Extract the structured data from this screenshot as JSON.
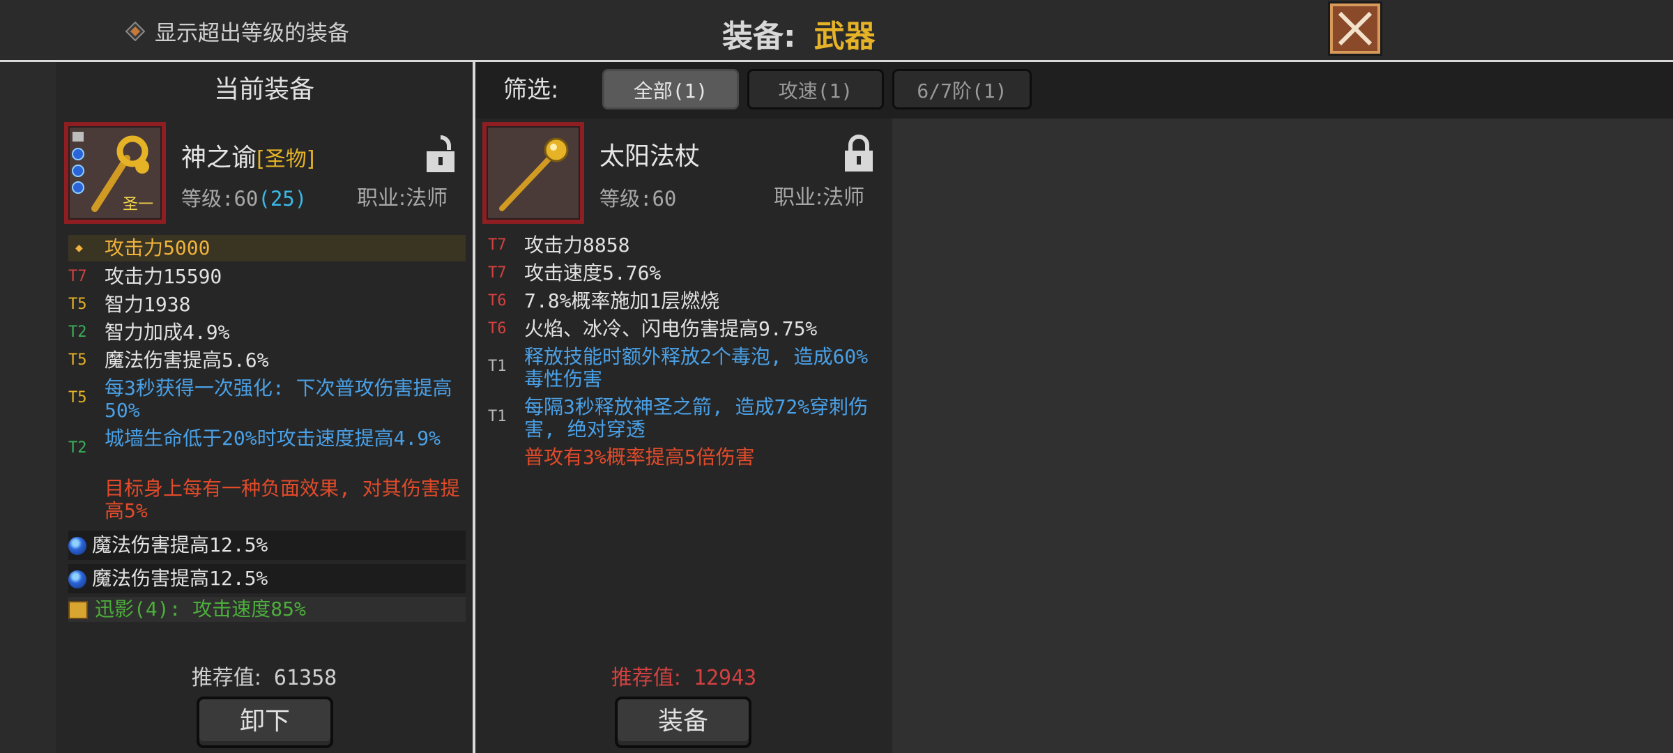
{
  "topbar": {
    "toggle_label": "显示超出等级的装备",
    "title_label": "装备:",
    "title_value": "武器"
  },
  "current": {
    "header": "当前装备",
    "name": "神之谕",
    "tag": "[圣物]",
    "icon_sub": "圣一",
    "level_label": "等级:",
    "level": "60",
    "level_bonus": "(25)",
    "class_label": "职业:",
    "class": "法师",
    "main_stat": "攻击力5000",
    "stats": [
      {
        "tier": "T7",
        "text": "攻击力15590"
      },
      {
        "tier": "T5",
        "text": "智力1938"
      },
      {
        "tier": "T2",
        "text": "智力加成4.9%"
      },
      {
        "tier": "T5",
        "text": "魔法伤害提高5.6%"
      },
      {
        "tier": "T5",
        "text": "每3秒获得一次强化: 下次普攻伤害提高50%"
      },
      {
        "tier": "T2",
        "text": "城墙生命低于20%时攻击速度提高4.9%"
      }
    ],
    "special": "目标身上每有一种负面效果, 对其伤害提高5%",
    "gems": [
      "魔法伤害提高12.5%",
      "魔法伤害提高12.5%"
    ],
    "set_bonus": "迅影(4): 攻击速度85%",
    "rec_label": "推荐值:",
    "rec_value": "61358",
    "button": "卸下"
  },
  "filter": {
    "label": "筛选:",
    "chips": [
      "全部(1)",
      "攻速(1)",
      "6/7阶(1)"
    ]
  },
  "candidate": {
    "name": "太阳法杖",
    "level_label": "等级:",
    "level": "60",
    "class_label": "职业:",
    "class": "法师",
    "stats": [
      {
        "tier": "T7",
        "text": "攻击力8858"
      },
      {
        "tier": "T7",
        "text": "攻击速度5.76%"
      },
      {
        "tier": "T6",
        "text": "7.8%概率施加1层燃烧"
      },
      {
        "tier": "T6",
        "text": "火焰、冰冷、闪电伤害提高9.75%"
      },
      {
        "tier": "T1",
        "text": "释放技能时额外释放2个毒泡, 造成60%毒性伤害"
      },
      {
        "tier": "T1",
        "text": "每隔3秒释放神圣之箭, 造成72%穿刺伤害, 绝对穿透"
      }
    ],
    "special": "普攻有3%概率提高5倍伤害",
    "rec_label": "推荐值:",
    "rec_value": "12943",
    "button": "装备"
  },
  "colors": {
    "accent_gold": "#e6b327",
    "tier_red": "#d24141",
    "tier_green": "#3aae5a",
    "skill_blue": "#4aa0e6",
    "special_red": "#e24b2a",
    "frame_red": "#8f1e23"
  },
  "icons": [
    "diamond-toggle-icon",
    "close-icon",
    "unlocked-icon",
    "locked-icon",
    "gem-icon",
    "set-book-icon",
    "staff-icon"
  ]
}
